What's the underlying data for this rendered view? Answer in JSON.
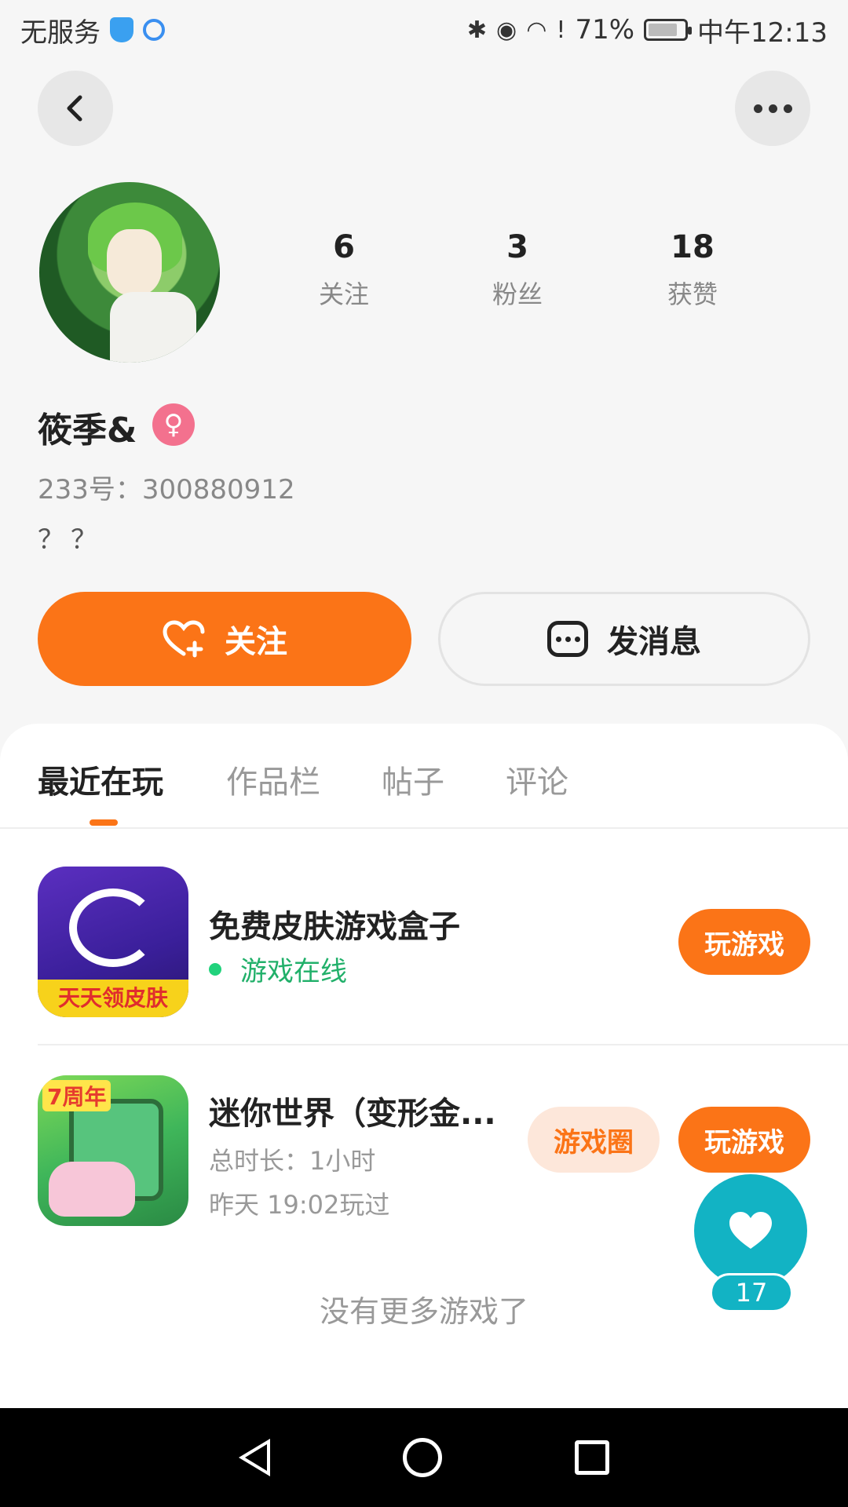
{
  "status_bar": {
    "carrier": "无服务",
    "battery": "71%",
    "time": "中午12:13",
    "icons": [
      "shield-icon",
      "globe-icon",
      "bluetooth-icon",
      "eye-icon",
      "wifi-icon",
      "alert-icon",
      "battery-icon"
    ]
  },
  "header": {
    "back_icon": "chevron-left-icon",
    "more_icon": "more-dots-icon"
  },
  "profile": {
    "stats": [
      {
        "num": "6",
        "label": "关注"
      },
      {
        "num": "3",
        "label": "粉丝"
      },
      {
        "num": "18",
        "label": "获赞"
      }
    ],
    "username": "筱季&",
    "gender_symbol": "♀",
    "uid": "233号：300880912",
    "bio": "？？",
    "follow_label": "关注",
    "message_label": "发消息"
  },
  "tabs": [
    {
      "label": "最近在玩",
      "active": true
    },
    {
      "label": "作品栏",
      "active": false
    },
    {
      "label": "帖子",
      "active": false
    },
    {
      "label": "评论",
      "active": false
    }
  ],
  "games": [
    {
      "title": "免费皮肤游戏盒子",
      "status": "游戏在线",
      "icon_banner": "天天领皮肤",
      "play_label": "玩游戏"
    },
    {
      "title": "迷你世界（变形金...",
      "duration": "总时长：1小时",
      "last_played": "昨天 19:02玩过",
      "icon_badge": "7周年",
      "circle_label": "游戏圈",
      "play_label": "玩游戏"
    }
  ],
  "no_more": "没有更多游戏了",
  "like": {
    "count": "17"
  },
  "colors": {
    "accent": "#fb7417",
    "online": "#21b06a",
    "like_fab": "#12b3c4",
    "gender": "#f3718e"
  }
}
